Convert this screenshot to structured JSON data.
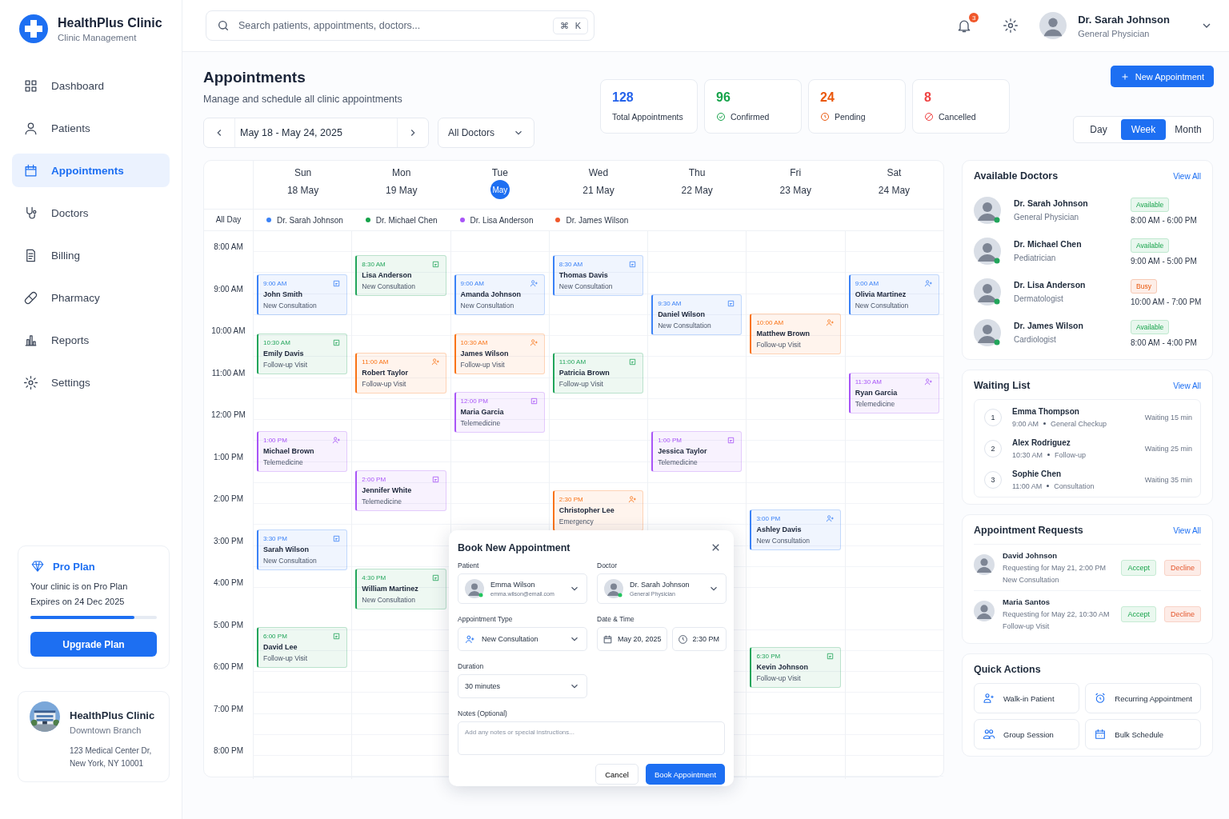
{
  "brand": {
    "name": "HealthPlus Clinic",
    "tagline": "Clinic Management"
  },
  "nav": [
    {
      "label": "Dashboard",
      "kind": "dashboard",
      "selected": false
    },
    {
      "label": "Patients",
      "kind": "patients",
      "selected": false
    },
    {
      "label": "Appointments",
      "kind": "appointments",
      "selected": true
    },
    {
      "label": "Doctors",
      "kind": "doctors",
      "selected": false
    },
    {
      "label": "Billing",
      "kind": "billing",
      "selected": false
    },
    {
      "label": "Pharmacy",
      "kind": "pharmacy",
      "selected": false
    },
    {
      "label": "Reports",
      "kind": "reports",
      "selected": false
    },
    {
      "label": "Settings",
      "kind": "settings",
      "selected": false
    }
  ],
  "plan": {
    "title": "Pro Plan",
    "text": "Your clinic is on Pro Plan",
    "expires": "Expires on 24 Dec 2025",
    "level": 0.82,
    "button": "Upgrade Plan"
  },
  "clinic": {
    "name": "HealthPlus Clinic",
    "branch": "Downtown Branch",
    "address": [
      "123 Medical Center Dr,",
      "New York, NY 10001"
    ]
  },
  "search": {
    "placeholder": "Search patients, appointments, doctors...",
    "shortcut": [
      "⌘",
      "K"
    ]
  },
  "notifications": "3",
  "user": {
    "name": "Dr. Sarah Johnson",
    "role": "General Physician"
  },
  "page": {
    "title": "Appointments",
    "subtitle": "Manage and schedule all clinic appointments"
  },
  "range": "May 18 - May 24, 2025",
  "doctor_filter": "All Doctors",
  "stats": [
    {
      "value": "128",
      "label": "Total Appointments",
      "color": "#2563eb",
      "kind": "total"
    },
    {
      "value": "96",
      "label": "Confirmed",
      "color": "#16a34a",
      "kind": "confirmed"
    },
    {
      "value": "24",
      "label": "Pending",
      "color": "#ea580c",
      "kind": "pending"
    },
    {
      "value": "8",
      "label": "Cancelled",
      "color": "#ef4444",
      "kind": "cancelled"
    }
  ],
  "new_button": "New Appointment",
  "views": [
    {
      "label": "Day",
      "selected": false
    },
    {
      "label": "Week",
      "selected": true
    },
    {
      "label": "Month",
      "selected": false
    }
  ],
  "calendar": {
    "allday_label": "All Day",
    "legend": [
      {
        "name": "Dr. Sarah Johnson",
        "color": "#3b82f6"
      },
      {
        "name": "Dr. Michael Chen",
        "color": "#16a34a"
      },
      {
        "name": "Dr. Lisa Anderson",
        "color": "#a855f7"
      },
      {
        "name": "Dr. James Wilson",
        "color": "#f0572a"
      }
    ],
    "hours": [
      "8:00 AM",
      "9:00 AM",
      "10:00 AM",
      "11:00 AM",
      "12:00 PM",
      "1:00 PM",
      "2:00 PM",
      "3:00 PM",
      "4:00 PM",
      "5:00 PM",
      "6:00 PM",
      "7:00 PM",
      "8:00 PM"
    ],
    "days": [
      {
        "name": "Sun",
        "date": "18 May",
        "selected": false,
        "events": [
          {
            "time": "9:00 AM",
            "name": "John Smith",
            "type": "New Consultation",
            "color": "#3b82f6",
            "kind": "record"
          },
          {
            "time": "10:30 AM",
            "name": "Emily Davis",
            "type": "Follow-up Visit",
            "color": "#22a55b",
            "kind": "record"
          },
          {
            "time": "1:00 PM",
            "name": "Michael Brown",
            "type": "Telemedicine",
            "color": "#a855f7",
            "kind": "patient"
          },
          {
            "time": "3:30 PM",
            "name": "Sarah Wilson",
            "type": "New Consultation",
            "color": "#3b82f6",
            "kind": "record"
          },
          {
            "time": "6:00 PM",
            "name": "David Lee",
            "type": "Follow-up Visit",
            "color": "#22a55b",
            "kind": "record"
          }
        ]
      },
      {
        "name": "Mon",
        "date": "19 May",
        "selected": false,
        "events": [
          {
            "time": "8:30 AM",
            "name": "Lisa Anderson",
            "type": "New Consultation",
            "color": "#22a55b",
            "kind": "record"
          },
          {
            "time": "11:00 AM",
            "name": "Robert Taylor",
            "type": "Follow-up Visit",
            "color": "#f97316",
            "kind": "patient"
          },
          {
            "time": "2:00 PM",
            "name": "Jennifer White",
            "type": "Telemedicine",
            "color": "#a855f7",
            "kind": "record"
          },
          {
            "time": "4:30 PM",
            "name": "William Martinez",
            "type": "New Consultation",
            "color": "#22a55b",
            "kind": "record"
          }
        ]
      },
      {
        "name": "Tue",
        "date": "May",
        "selected": true,
        "events": [
          {
            "time": "9:00 AM",
            "name": "Amanda Johnson",
            "type": "New Consultation",
            "color": "#3b82f6",
            "kind": "patient"
          },
          {
            "time": "10:30 AM",
            "name": "James Wilson",
            "type": "Follow-up Visit",
            "color": "#f97316",
            "kind": "patient"
          },
          {
            "time": "12:00 PM",
            "name": "Maria Garcia",
            "type": "Telemedicine",
            "color": "#a855f7",
            "kind": "record"
          }
        ]
      },
      {
        "name": "Wed",
        "date": "21 May",
        "selected": false,
        "events": [
          {
            "time": "8:30 AM",
            "name": "Thomas Davis",
            "type": "New Consultation",
            "color": "#3b82f6",
            "kind": "record"
          },
          {
            "time": "11:00 AM",
            "name": "Patricia Brown",
            "type": "Follow-up Visit",
            "color": "#22a55b",
            "kind": "record"
          },
          {
            "time": "2:30 PM",
            "name": "Christopher Lee",
            "type": "Emergency",
            "color": "#f97316",
            "kind": "patient"
          }
        ]
      },
      {
        "name": "Thu",
        "date": "22 May",
        "selected": false,
        "events": [
          {
            "time": "9:30 AM",
            "name": "Daniel Wilson",
            "type": "New Consultation",
            "color": "#3b82f6",
            "kind": "record"
          },
          {
            "time": "1:00 PM",
            "name": "Jessica Taylor",
            "type": "Telemedicine",
            "color": "#a855f7",
            "kind": "record"
          }
        ]
      },
      {
        "name": "Fri",
        "date": "23 May",
        "selected": false,
        "events": [
          {
            "time": "10:00 AM",
            "name": "Matthew Brown",
            "type": "Follow-up Visit",
            "color": "#f97316",
            "kind": "patient"
          },
          {
            "time": "3:00 PM",
            "name": "Ashley Davis",
            "type": "New Consultation",
            "color": "#3b82f6",
            "kind": "patient"
          },
          {
            "time": "6:30 PM",
            "name": "Kevin Johnson",
            "type": "Follow-up Visit",
            "color": "#22a55b",
            "kind": "record"
          }
        ]
      },
      {
        "name": "Sat",
        "date": "24 May",
        "selected": false,
        "events": [
          {
            "time": "9:00 AM",
            "name": "Olivia Martinez",
            "type": "New Consultation",
            "color": "#3b82f6",
            "kind": "patient"
          },
          {
            "time": "11:30 AM",
            "name": "Ryan Garcia",
            "type": "Telemedicine",
            "color": "#a855f7",
            "kind": "patient"
          }
        ]
      }
    ]
  },
  "booking": {
    "title": "Book New Appointment",
    "patient": {
      "label": "Patient",
      "name": "Emma Wilson",
      "detail": "emma.wilson@email.com"
    },
    "doctor": {
      "label": "Doctor",
      "name": "Dr. Sarah Johnson",
      "detail": "General Physician"
    },
    "type": {
      "label": "Appointment Type",
      "value": "New Consultation"
    },
    "datetime": {
      "label": "Date & Time",
      "date": "May 20, 2025",
      "time": "2:30 PM"
    },
    "duration": {
      "label": "Duration",
      "value": "30 minutes"
    },
    "notes": {
      "label": "Notes (Optional)",
      "placeholder": "Add any notes or special instructions..."
    },
    "cancel": "Cancel",
    "submit": "Book Appointment"
  },
  "doctors": {
    "title": "Available Doctors",
    "link": "View All",
    "items": [
      {
        "name": "Dr. Sarah Johnson",
        "specialty": "General Physician",
        "status": "Available",
        "kind": "available",
        "hours": "8:00 AM - 6:00 PM"
      },
      {
        "name": "Dr. Michael Chen",
        "specialty": "Pediatrician",
        "status": "Available",
        "kind": "available",
        "hours": "9:00 AM - 5:00 PM"
      },
      {
        "name": "Dr. Lisa Anderson",
        "specialty": "Dermatologist",
        "status": "Busy",
        "kind": "busy",
        "hours": "10:00 AM - 7:00 PM"
      },
      {
        "name": "Dr. James Wilson",
        "specialty": "Cardiologist",
        "status": "Available",
        "kind": "available",
        "hours": "8:00 AM - 4:00 PM"
      }
    ]
  },
  "waiting": {
    "title": "Waiting List",
    "link": "View All",
    "items": [
      {
        "number": "1",
        "name": "Emma Thompson",
        "time": "9:00 AM",
        "type": "General Checkup",
        "wait": "Waiting 15 min"
      },
      {
        "number": "2",
        "name": "Alex Rodriguez",
        "time": "10:30 AM",
        "type": "Follow-up",
        "wait": "Waiting 25 min"
      },
      {
        "number": "3",
        "name": "Sophie Chen",
        "time": "11:00 AM",
        "type": "Consultation",
        "wait": "Waiting 35 min"
      }
    ]
  },
  "requests": {
    "title": "Appointment Requests",
    "link": "View All",
    "items": [
      {
        "name": "David Johnson",
        "request": "Requesting for May 21, 2:00 PM",
        "type": "New Consultation",
        "accept": "Accept",
        "decline": "Decline"
      },
      {
        "name": "Maria Santos",
        "request": "Requesting for May 22, 10:30 AM",
        "type": "Follow-up Visit",
        "accept": "Accept",
        "decline": "Decline"
      }
    ]
  },
  "quick": {
    "title": "Quick Actions",
    "items": [
      {
        "label": "Walk-in Patient",
        "kind": "walkin"
      },
      {
        "label": "Recurring Appointment",
        "kind": "recurring"
      },
      {
        "label": "Group Session",
        "kind": "group"
      },
      {
        "label": "Bulk Schedule",
        "kind": "bulk"
      }
    ]
  }
}
